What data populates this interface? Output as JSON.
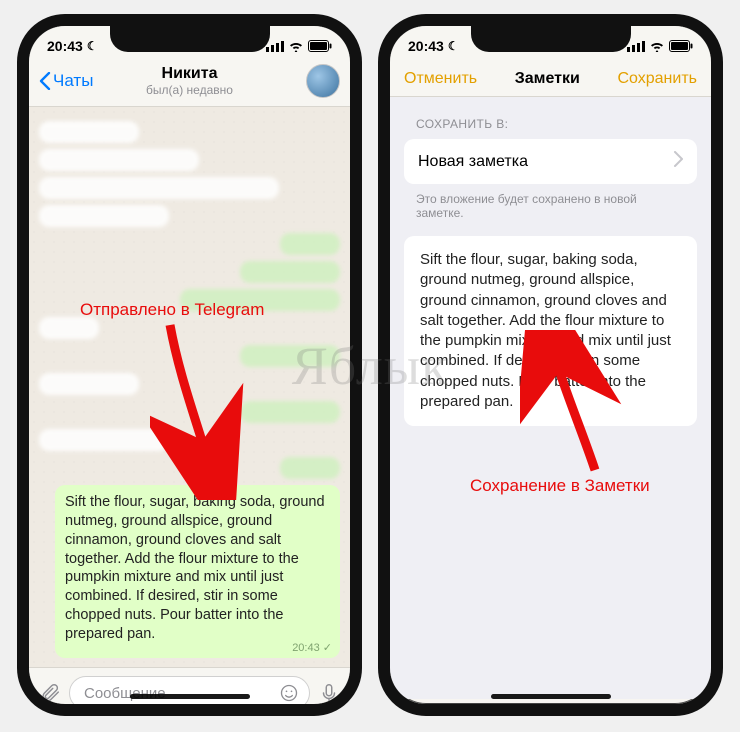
{
  "status": {
    "time": "20:43",
    "moon": "☾"
  },
  "telegram": {
    "back": "Чаты",
    "title": "Никита",
    "subtitle": "был(а) недавно",
    "message": "Sift the flour, sugar, baking soda, ground nutmeg, ground allspice, ground cinnamon, ground cloves and salt together. Add the flour mixture to the pumpkin mixture and mix until just combined. If desired, stir in some chopped nuts. Pour batter into the prepared pan.",
    "msg_time": "20:43 ✓",
    "input_placeholder": "Сообщение"
  },
  "notes": {
    "cancel": "Отменить",
    "title": "Заметки",
    "save": "Сохранить",
    "section": "СОХРАНИТЬ В:",
    "row": "Новая заметка",
    "hint": "Это вложение будет сохранено в новой заметке.",
    "content": "Sift the flour, sugar, baking soda, ground nutmeg, ground allspice, ground cinnamon, ground cloves and salt together. Add the flour mixture to the pumpkin mixture and mix until just combined. If desired, stir in some chopped nuts. Pour batter into the prepared pan."
  },
  "annotations": {
    "left": "Отправлено в Telegram",
    "right": "Сохранение в Заметки"
  },
  "watermark": "Яблык"
}
